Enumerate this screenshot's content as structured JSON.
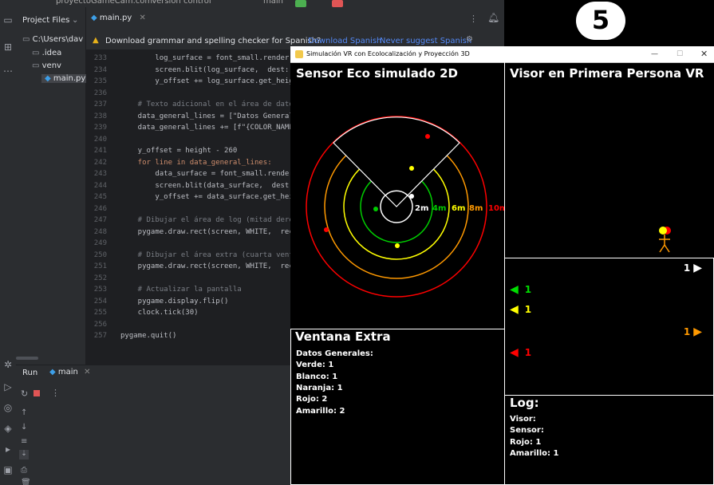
{
  "ide": {
    "top_text": "proyectoGameCam.com",
    "top_text2": "Version control",
    "top_text3": "main",
    "project_label": "Project Files",
    "tree": [
      {
        "label": "C:\\Users\\dav",
        "kind": "folder"
      },
      {
        "label": ".idea",
        "kind": "folder"
      },
      {
        "label": "venv",
        "kind": "folder"
      },
      {
        "label": "main.py",
        "kind": "file"
      }
    ],
    "tab_label": "main.py",
    "banner_text": "Download grammar and spelling checker for Spanish?",
    "banner_action1": "Download Spanish",
    "banner_action2": "Never suggest Spanish",
    "code_lines": [
      {
        "n": "233",
        "t": "        log_surface = font_small.render("
      },
      {
        "n": "234",
        "t": "        screen.blit(log_surface,  dest: (w"
      },
      {
        "n": "235",
        "t": "        y_offset += log_surface.get_heig"
      },
      {
        "n": "236",
        "t": ""
      },
      {
        "n": "237",
        "t": "    # Texto adicional en el área de dato"
      },
      {
        "n": "238",
        "t": "    data_general_lines = [\"Datos General"
      },
      {
        "n": "239",
        "t": "    data_general_lines += [f\"{COLOR_NAME"
      },
      {
        "n": "240",
        "t": ""
      },
      {
        "n": "241",
        "t": "    y_offset = height - 260"
      },
      {
        "n": "242",
        "t": "    for line in data_general_lines:"
      },
      {
        "n": "243",
        "t": "        data_surface = font_small.render"
      },
      {
        "n": "244",
        "t": "        screen.blit(data_surface,  dest: ("
      },
      {
        "n": "245",
        "t": "        y_offset += data_surface.get_hei"
      },
      {
        "n": "246",
        "t": ""
      },
      {
        "n": "247",
        "t": "    # Dibujar el área de log (mitad dere"
      },
      {
        "n": "248",
        "t": "    pygame.draw.rect(screen, WHITE,  rect"
      },
      {
        "n": "249",
        "t": ""
      },
      {
        "n": "250",
        "t": "    # Dibujar el área extra (cuarta vent"
      },
      {
        "n": "251",
        "t": "    pygame.draw.rect(screen, WHITE,  rect"
      },
      {
        "n": "252",
        "t": ""
      },
      {
        "n": "253",
        "t": "    # Actualizar la pantalla"
      },
      {
        "n": "254",
        "t": "    pygame.display.flip()"
      },
      {
        "n": "255",
        "t": "    clock.tick(30)"
      },
      {
        "n": "256",
        "t": ""
      },
      {
        "n": "257",
        "t": "pygame.quit()"
      }
    ],
    "run_tab_label": "Run",
    "run_config": "main"
  },
  "window": {
    "title": "Simulación VR con Ecolocalización y Proyección 3D",
    "minimize_glyph": "—",
    "maximize_glyph": "☐",
    "close_glyph": "✕"
  },
  "sensor": {
    "title": "Sensor Eco simulado 2D",
    "ring_labels": [
      "2m",
      "4m",
      "6m",
      "8m",
      "10m"
    ],
    "ring_colors": [
      "#ffffff",
      "#00cc00",
      "#ffff00",
      "#ff9900",
      "#ff0000"
    ]
  },
  "visor": {
    "title": "Visor en Primera Persona VR"
  },
  "arrows": [
    {
      "count": "1",
      "color": "#ffffff",
      "dir": "right"
    },
    {
      "count": "1",
      "color": "#00dd00",
      "dir": "left"
    },
    {
      "count": "1",
      "color": "#ffff00",
      "dir": "left"
    },
    {
      "count": "1",
      "color": "#ff9900",
      "dir": "right"
    },
    {
      "count": "1",
      "color": "#ff0000",
      "dir": "left"
    }
  ],
  "extra": {
    "title": "Ventana Extra",
    "lines": [
      "Datos Generales:",
      "Verde: 1",
      "Blanco: 1",
      "Naranja: 1",
      "Rojo: 2",
      "Amarillo: 2"
    ]
  },
  "log": {
    "title": "Log:",
    "lines": [
      "Visor:",
      "Sensor:",
      "Rojo: 1",
      "Amarillo: 1"
    ]
  },
  "badge": {
    "number": "5"
  }
}
